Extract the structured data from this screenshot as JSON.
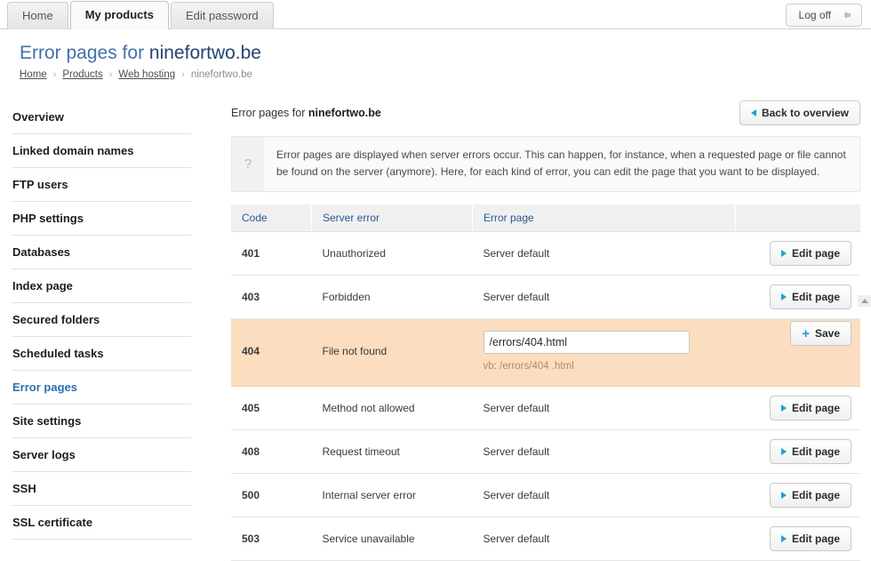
{
  "topbar": {
    "tabs": [
      {
        "label": "Home",
        "active": false
      },
      {
        "label": "My products",
        "active": true
      },
      {
        "label": "Edit password",
        "active": false
      }
    ],
    "logoff_label": "Log off",
    "logoff_icon": "arrow-right-icon"
  },
  "header": {
    "title_prefix": "Error pages for",
    "title_domain": "ninefortwo.be",
    "breadcrumb": [
      {
        "label": "Home",
        "link": true
      },
      {
        "label": "Products",
        "link": true
      },
      {
        "label": "Web hosting",
        "link": true
      },
      {
        "label": "ninefortwo.be",
        "link": false
      }
    ],
    "breadcrumb_separator": "›"
  },
  "sidebar": {
    "items": [
      {
        "label": "Overview",
        "active": false
      },
      {
        "label": "Linked domain names",
        "active": false
      },
      {
        "label": "FTP users",
        "active": false
      },
      {
        "label": "PHP settings",
        "active": false
      },
      {
        "label": "Databases",
        "active": false
      },
      {
        "label": "Index page",
        "active": false
      },
      {
        "label": "Secured folders",
        "active": false
      },
      {
        "label": "Scheduled tasks",
        "active": false
      },
      {
        "label": "Error pages",
        "active": true
      },
      {
        "label": "Site settings",
        "active": false
      },
      {
        "label": "Server logs",
        "active": false
      },
      {
        "label": "SSH",
        "active": false
      },
      {
        "label": "SSL certificate",
        "active": false
      }
    ]
  },
  "content": {
    "heading_prefix": "Error pages for",
    "heading_domain": "ninefortwo.be",
    "back_button": "Back to overview",
    "back_icon": "triangle-left-icon",
    "info": {
      "icon": "question-mark-icon",
      "text": "Error pages are displayed when server errors occur. This can happen, for instance, when a requested page or file cannot be found on the server (anymore). Here, for each kind of error, you can edit the page that you want to be displayed."
    },
    "table": {
      "columns": [
        "Code",
        "Server error",
        "Error page",
        ""
      ],
      "edit_label": "Edit page",
      "edit_icon": "triangle-right-icon",
      "save_label": "Save",
      "save_icon": "plus-icon",
      "default_value": "Server default",
      "rows": [
        {
          "code": "401",
          "error": "Unauthorized",
          "page": "Server default",
          "editing": false
        },
        {
          "code": "403",
          "error": "Forbidden",
          "page": "Server default",
          "editing": false
        },
        {
          "code": "404",
          "error": "File not found",
          "page": "/errors/404.html",
          "hint": "vb: /errors/404 .html",
          "editing": true
        },
        {
          "code": "405",
          "error": "Method not allowed",
          "page": "Server default",
          "editing": false
        },
        {
          "code": "408",
          "error": "Request timeout",
          "page": "Server default",
          "editing": false
        },
        {
          "code": "500",
          "error": "Internal server error",
          "page": "Server default",
          "editing": false
        },
        {
          "code": "503",
          "error": "Service unavailable",
          "page": "Server default",
          "editing": false
        }
      ]
    }
  },
  "colors": {
    "accent_blue": "#2f6fb0",
    "icon_blue": "#1f9ed8",
    "active_row": "#fbddbf",
    "title_blue": "#3f72a8"
  }
}
